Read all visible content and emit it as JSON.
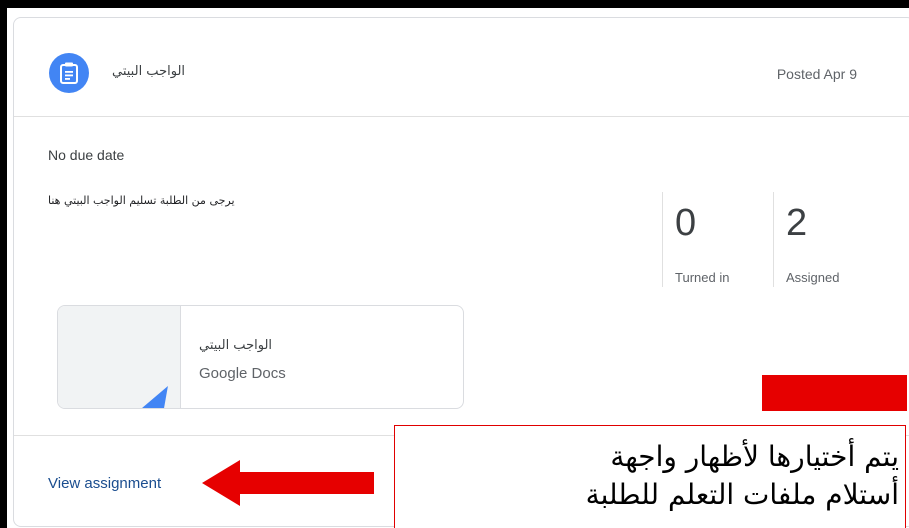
{
  "assignment": {
    "title": "الواجب البيتي",
    "posted": "Posted Apr 9",
    "due": "No due date",
    "instructions": "يرجى من الطلبة تسليم الواجب البيتي هنا"
  },
  "stats": [
    {
      "value": "0",
      "label": "Turned in"
    },
    {
      "value": "2",
      "label": "Assigned"
    }
  ],
  "attachment": {
    "title": "الواجب البيتي",
    "type": "Google Docs"
  },
  "footer": {
    "view_label": "View assignment"
  },
  "annotation": {
    "text_line1": "يتم أختيارها لأظهار واجهة",
    "text_line2": "أستلام ملفات التعلم للطلبة",
    "color": "#e60000"
  },
  "colors": {
    "accent": "#4285f4",
    "link": "#1a4d8f"
  }
}
